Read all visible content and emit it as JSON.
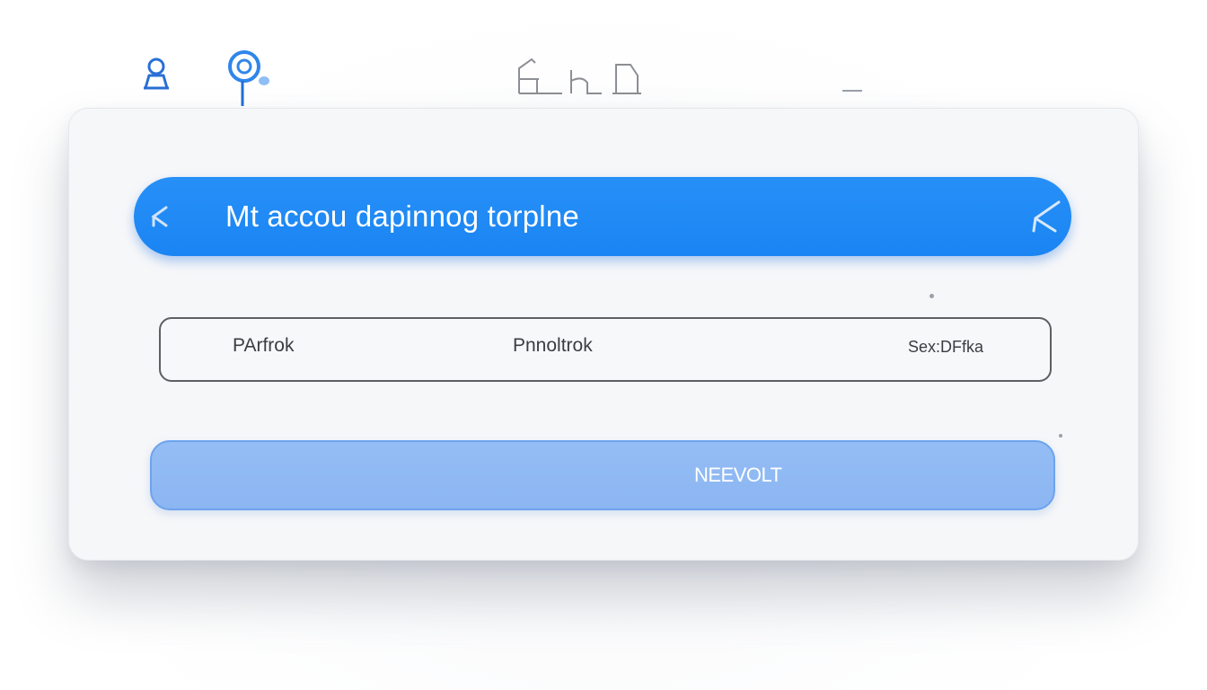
{
  "top_icons": [
    {
      "name": "user-icon"
    },
    {
      "name": "location-pin-icon"
    },
    {
      "name": "documents-icon"
    },
    {
      "name": "minimize-icon"
    }
  ],
  "colors": {
    "accent": "#1a84f3",
    "button": "#8cb6f2",
    "border": "#5d5f63",
    "card": "#f6f7f9"
  },
  "header": {
    "title": "Mt accou   dapinnog torplne",
    "back_icon": "back-chevron-icon",
    "close_icon": "close-icon"
  },
  "tabs": [
    {
      "label": "PArfrok"
    },
    {
      "label": "Pnnoltrok"
    },
    {
      "label": "Sex:DFfka"
    }
  ],
  "primary_button": {
    "label": "NEEVOLT"
  }
}
